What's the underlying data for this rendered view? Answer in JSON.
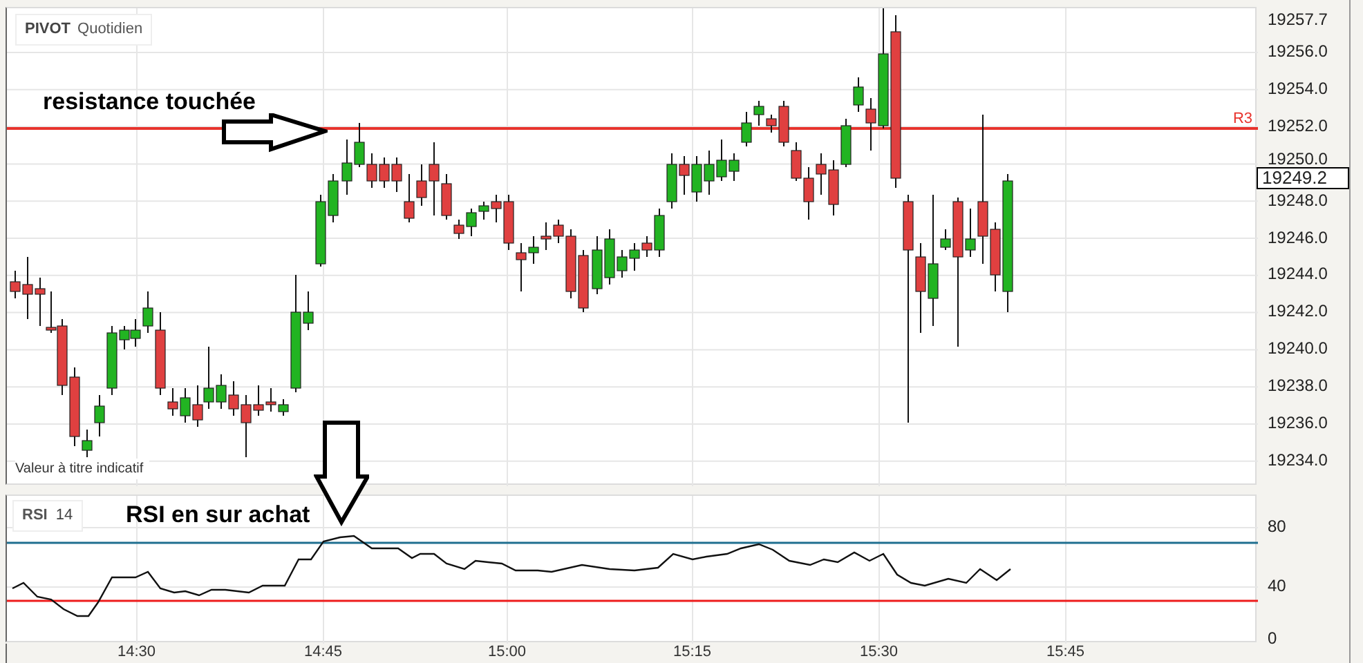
{
  "price_chart": {
    "symbol": "PIVOT",
    "period": "Quotidien",
    "annotation": "resistance touchée",
    "pivot_label": "R3",
    "disclaimer": "Valeur à titre indicatif"
  },
  "price_axis": {
    "ticks": [
      "19257.7",
      "19256.0",
      "19254.0",
      "19252.0",
      "19250.0",
      "19248.0",
      "19246.0",
      "19244.0",
      "19242.0",
      "19240.0",
      "19238.0",
      "19236.0",
      "19234.0"
    ],
    "current_price": "19249.2"
  },
  "rsi_panel": {
    "name": "RSI",
    "period": "14",
    "annotation": "RSI en sur achat",
    "ticks": [
      "80",
      "40",
      "0"
    ]
  },
  "time_axis": {
    "ticks": [
      "14:30",
      "14:45",
      "15:00",
      "15:15",
      "15:30",
      "15:45"
    ]
  }
}
